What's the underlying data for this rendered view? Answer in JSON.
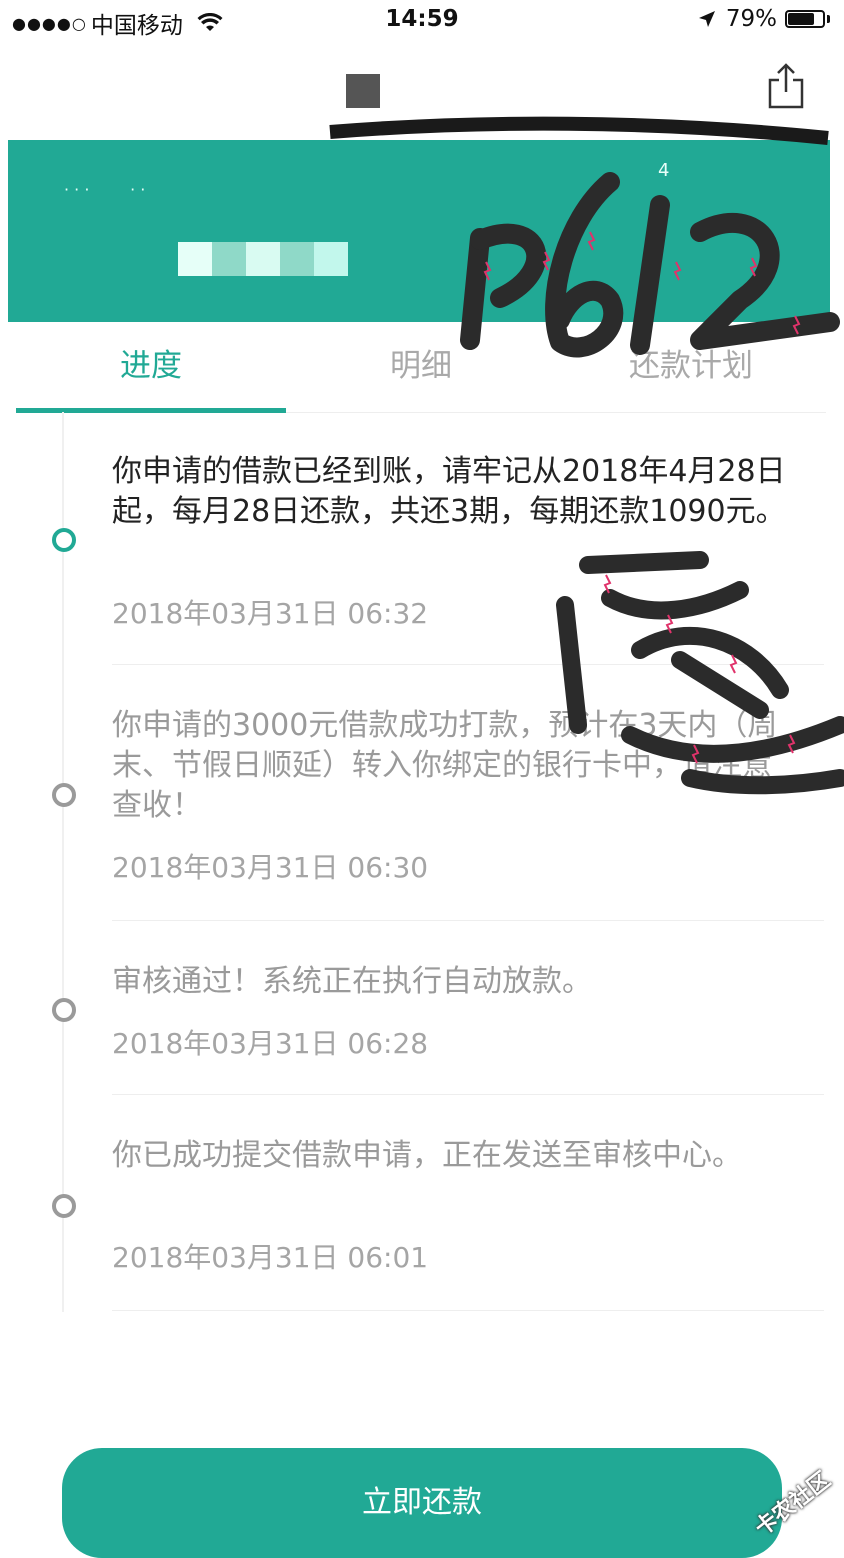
{
  "status_bar": {
    "signal": "●●●●○",
    "carrier": "中国移动",
    "time": "14:59",
    "battery": "79%",
    "battery_level": 0.79
  },
  "header": {
    "small_text": "4",
    "blur_colors": [
      "#e6fff8",
      "#8fd9c8",
      "#d9fbf2",
      "#8fd9c8",
      "#c2f7ec"
    ]
  },
  "tabs": [
    {
      "label": "进度",
      "active": true
    },
    {
      "label": "明细",
      "active": false
    },
    {
      "label": "还款计划",
      "active": false
    }
  ],
  "events": [
    {
      "text": "你申请的借款已经到账，请牢记从2018年4月28日起，每月28日还款，共还3期，每期还款1090元。",
      "time": "2018年03月31日 06:32",
      "current": true
    },
    {
      "text": "你申请的3000元借款成功打款，预计在3天内（周末、节假日顺延）转入你绑定的银行卡中，请注意查收！",
      "time": "2018年03月31日 06:30",
      "current": false
    },
    {
      "text": "审核通过！系统正在执行自动放款。",
      "time": "2018年03月31日 06:28",
      "current": false
    },
    {
      "text": "你已成功提交借款申请，正在发送至审核中心。",
      "time": "2018年03月31日 06:01",
      "current": false
    }
  ],
  "repay_button": {
    "label": "立即还款"
  },
  "annotations": {
    "handwriting_1": "P6l2",
    "handwriting_2": "哒"
  },
  "watermark": "卡农社区",
  "colors": {
    "accent": "#21a995",
    "text_primary": "#222222",
    "text_secondary": "#9a9a9a",
    "scribble": "#2b2b2b",
    "scribble_mark": "#e0336b"
  },
  "icons": {
    "wifi": "wifi-icon",
    "location": "location-arrow-icon",
    "battery": "battery-icon",
    "share": "share-icon"
  }
}
